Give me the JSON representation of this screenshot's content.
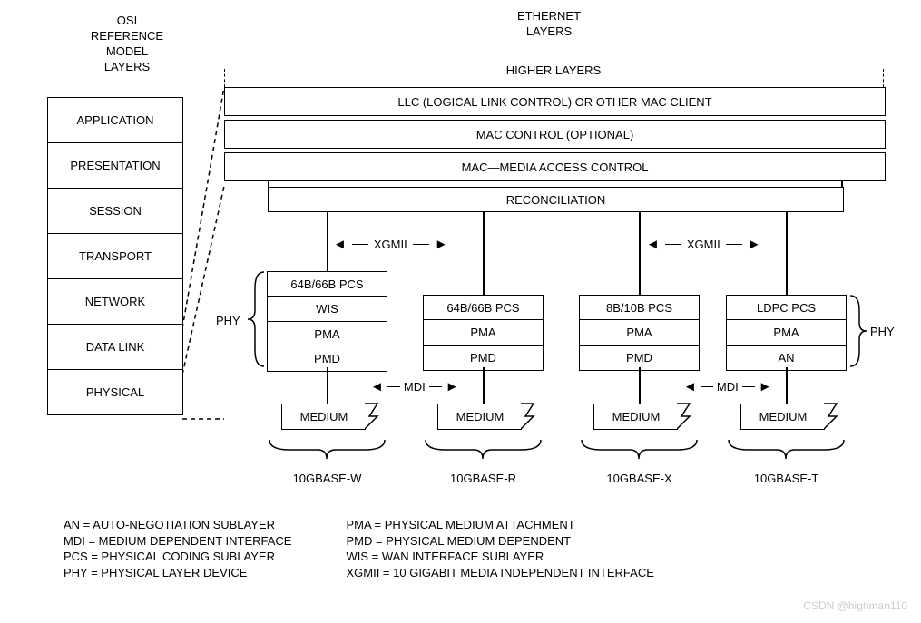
{
  "osi_title": {
    "l1": "OSI",
    "l2": "REFERENCE",
    "l3": "MODEL",
    "l4": "LAYERS"
  },
  "eth_title": {
    "l1": "ETHERNET",
    "l2": "LAYERS"
  },
  "higher": "HIGHER LAYERS",
  "osi": {
    "l1": "APPLICATION",
    "l2": "PRESENTATION",
    "l3": "SESSION",
    "l4": "TRANSPORT",
    "l5": "NETWORK",
    "l6": "DATA LINK",
    "l7": "PHYSICAL"
  },
  "eth": {
    "llc": "LLC (LOGICAL LINK CONTROL) OR OTHER MAC CLIENT",
    "macctl": "MAC CONTROL (OPTIONAL)",
    "mac": "MAC—MEDIA ACCESS CONTROL",
    "recon": "RECONCILIATION"
  },
  "xgmii": "XGMII",
  "mdi": "MDI",
  "phy": "PHY",
  "cols": {
    "w": {
      "r1": "64B/66B PCS",
      "r2": "WIS",
      "r3": "PMA",
      "r4": "PMD",
      "medium": "MEDIUM",
      "label": "10GBASE-W"
    },
    "r": {
      "r1": "64B/66B PCS",
      "r2": "PMA",
      "r3": "PMD",
      "medium": "MEDIUM",
      "label": "10GBASE-R"
    },
    "x": {
      "r1": "8B/10B PCS",
      "r2": "PMA",
      "r3": "PMD",
      "medium": "MEDIUM",
      "label": "10GBASE-X"
    },
    "t": {
      "r1": "LDPC PCS",
      "r2": "PMA",
      "r3": "AN",
      "medium": "MEDIUM",
      "label": "10GBASE-T"
    }
  },
  "legend": {
    "left": {
      "l1": "AN = AUTO-NEGOTIATION SUBLAYER",
      "l2": "MDI = MEDIUM DEPENDENT INTERFACE",
      "l3": "PCS = PHYSICAL CODING SUBLAYER",
      "l4": "PHY = PHYSICAL LAYER DEVICE"
    },
    "right": {
      "l1": "PMA = PHYSICAL MEDIUM ATTACHMENT",
      "l2": "PMD = PHYSICAL MEDIUM DEPENDENT",
      "l3": "WIS = WAN INTERFACE SUBLAYER",
      "l4": "XGMII = 10 GIGABIT MEDIA INDEPENDENT INTERFACE"
    }
  },
  "watermark": "CSDN @highman110"
}
